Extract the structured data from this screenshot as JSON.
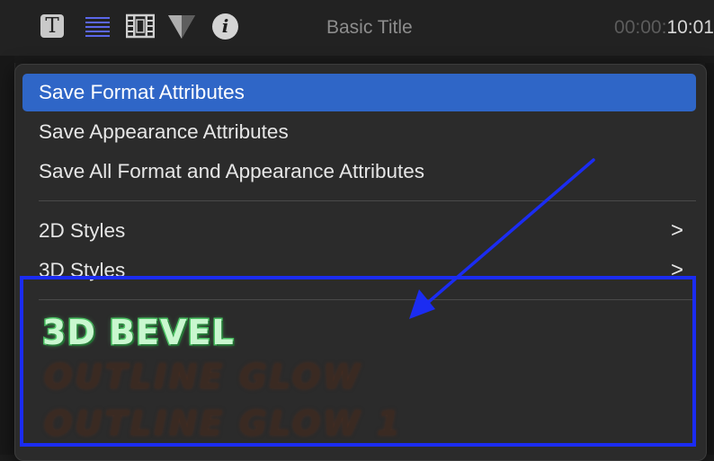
{
  "header": {
    "title": "Basic Title",
    "timecode_dim": "00:00:",
    "timecode_bright": "10:01",
    "icons": [
      "text-inspector-icon",
      "paragraph-lines-icon",
      "film-icon",
      "shape-icon",
      "info-icon"
    ]
  },
  "menu": {
    "items": [
      {
        "label": "Save Format Attributes",
        "selected": true
      },
      {
        "label": "Save Appearance Attributes"
      },
      {
        "label": "Save All Format and Appearance Attributes"
      }
    ],
    "submenus": [
      {
        "label": "2D Styles",
        "chevron": ">"
      },
      {
        "label": "3D Styles",
        "chevron": ">"
      }
    ],
    "presets": [
      "3D BEVEL",
      "OUTLINE GLOW",
      "OUTLINE GLOW 1"
    ]
  },
  "colors": {
    "selection": "#2f66c7",
    "menu_bg": "#2b2b2b",
    "annotation": "#1b2cf2"
  }
}
